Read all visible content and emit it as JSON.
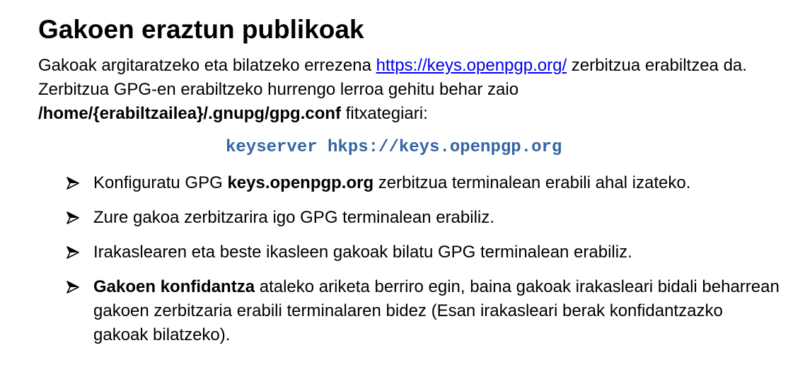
{
  "title": "Gakoen eraztun publikoak",
  "intro": {
    "text_before_link": "Gakoak argitaratzeko eta bilatzeko errezena ",
    "link": "https://keys.openpgp.org/",
    "text_after_link": " zerbitzua erabiltzea da. Zerbitzua GPG-en erabiltzeko hurrengo lerroa gehitu behar zaio ",
    "path": "/home/{erabiltzailea}/.gnupg/gpg.conf",
    "text_after_path": " fitxategiari:"
  },
  "code_line": "keyserver hkps://keys.openpgp.org",
  "colors": {
    "code": "#3465a4",
    "link": "#0000ee",
    "text": "#000000"
  },
  "tasks": [
    {
      "before": "Konfiguratu GPG ",
      "bold": "keys.openpgp.org",
      "after": " zerbitzua terminalean erabili ahal izateko."
    },
    {
      "before": "Zure gakoa zerbitzarira igo GPG terminalean erabiliz.",
      "bold": "",
      "after": ""
    },
    {
      "before": "Irakaslearen eta beste ikasleen gakoak bilatu GPG terminalean erabiliz.",
      "bold": "",
      "after": ""
    },
    {
      "before": "",
      "bold": "Gakoen konfidantza",
      "after": " ataleko ariketa berriro egin, baina gakoak irakasleari bidali beharrean gakoen zerbitzaria erabili terminalaren bidez (Esan irakasleari berak konfidantzazko gakoak bilatzeko)."
    }
  ],
  "bullet_icon": "arrowhead-bullet-icon"
}
